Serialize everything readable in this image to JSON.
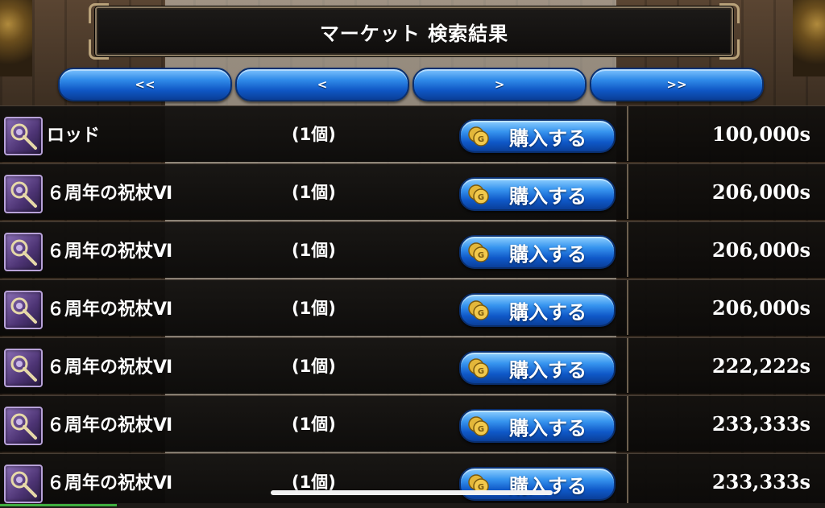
{
  "header": {
    "title": "マーケット 検索結果"
  },
  "pager": {
    "first": "<<",
    "prev": "<",
    "next": ">",
    "last": ">>"
  },
  "buy_label": "購入する",
  "rows": [
    {
      "icon": "staff-icon",
      "name": "ロッド",
      "qty": "(1個)",
      "price": "100,000s"
    },
    {
      "icon": "staff-icon",
      "name": "６周年の祝杖Ⅵ",
      "qty": "(1個)",
      "price": "206,000s"
    },
    {
      "icon": "staff-icon",
      "name": "６周年の祝杖Ⅵ",
      "qty": "(1個)",
      "price": "206,000s"
    },
    {
      "icon": "staff-icon",
      "name": "６周年の祝杖Ⅵ",
      "qty": "(1個)",
      "price": "206,000s"
    },
    {
      "icon": "staff-icon",
      "name": "６周年の祝杖Ⅵ",
      "qty": "(1個)",
      "price": "222,222s"
    },
    {
      "icon": "staff-icon",
      "name": "６周年の祝杖Ⅵ",
      "qty": "(1個)",
      "price": "233,333s"
    },
    {
      "icon": "staff-icon",
      "name": "６周年の祝杖Ⅵ",
      "qty": "(1個)",
      "price": "233,333s"
    }
  ],
  "colors": {
    "button_blue": "#0f56c4",
    "row_bg": "#0f0d0c",
    "border_gold": "#8a7a62"
  }
}
